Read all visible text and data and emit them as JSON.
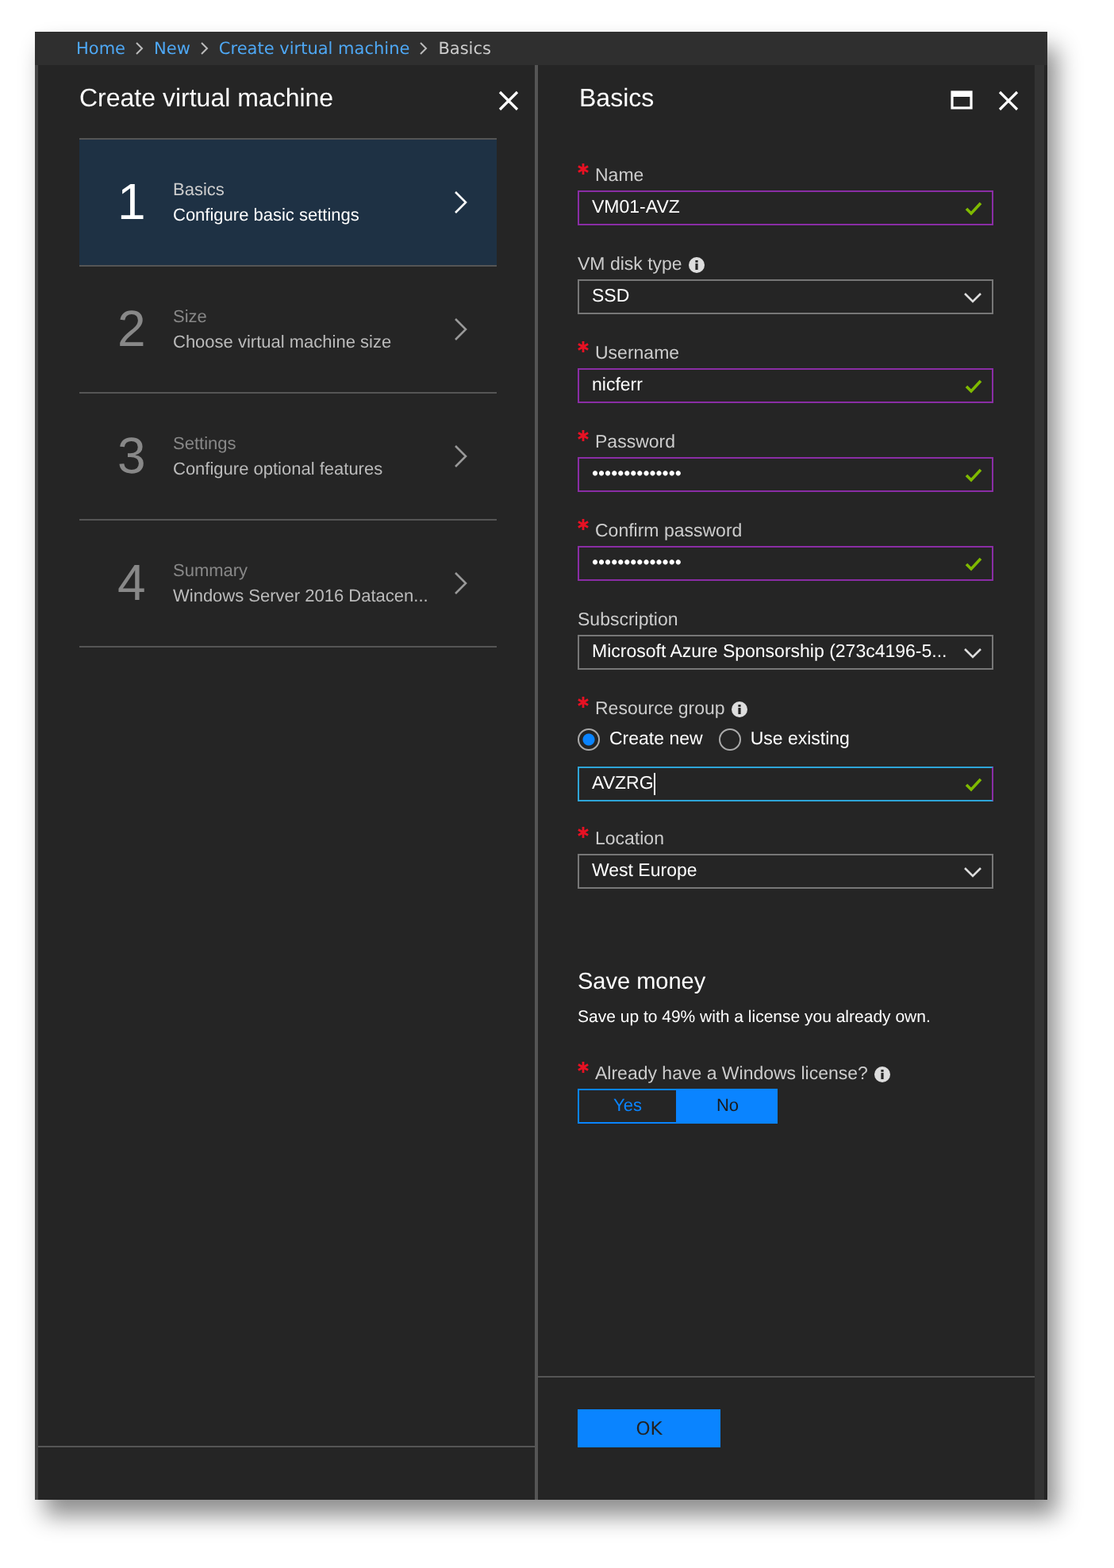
{
  "breadcrumb": [
    {
      "label": "Home",
      "current": false
    },
    {
      "label": "New",
      "current": false
    },
    {
      "label": "Create virtual machine",
      "current": false
    },
    {
      "label": "Basics",
      "current": true
    }
  ],
  "left_blade": {
    "title": "Create virtual machine",
    "steps": [
      {
        "number": "1",
        "title": "Basics",
        "subtitle": "Configure basic settings",
        "selected": true
      },
      {
        "number": "2",
        "title": "Size",
        "subtitle": "Choose virtual machine size",
        "selected": false
      },
      {
        "number": "3",
        "title": "Settings",
        "subtitle": "Configure optional features",
        "selected": false
      },
      {
        "number": "4",
        "title": "Summary",
        "subtitle": "Windows Server 2016 Datacen...",
        "selected": false
      }
    ]
  },
  "right_blade": {
    "title": "Basics",
    "fields": [
      {
        "kind": "text",
        "label": "Name",
        "required": true,
        "info": false,
        "value": "VM01-AVZ",
        "valid": true
      },
      {
        "kind": "select",
        "label": "VM disk type",
        "required": false,
        "info": true,
        "value": "SSD"
      },
      {
        "kind": "text",
        "label": "Username",
        "required": true,
        "info": false,
        "value": "nicferr",
        "valid": true
      },
      {
        "kind": "text",
        "label": "Password",
        "required": true,
        "info": false,
        "value": "••••••••••••••",
        "valid": true
      },
      {
        "kind": "text",
        "label": "Confirm password",
        "required": true,
        "info": false,
        "value": "••••••••••••••",
        "valid": true
      },
      {
        "kind": "select",
        "label": "Subscription",
        "required": false,
        "info": false,
        "value": "Microsoft Azure Sponsorship (273c4196-5..."
      },
      {
        "kind": "radio",
        "label": "Resource group",
        "required": true,
        "info": true,
        "options": [
          {
            "label": "Create new",
            "selected": true
          },
          {
            "label": "Use existing",
            "selected": false
          }
        ]
      },
      {
        "kind": "text",
        "value": "AVZRG",
        "valid": true,
        "focused": true
      },
      {
        "kind": "select",
        "label": "Location",
        "required": true,
        "info": false,
        "value": "West Europe"
      }
    ],
    "section": {
      "title": "Save money",
      "text": "Save up to 49% with a license you already own."
    },
    "license": {
      "label": "Already have a Windows license?",
      "required": true,
      "info": true,
      "options": [
        {
          "label": "Yes",
          "selected": false
        },
        {
          "label": "No",
          "selected": true
        }
      ]
    },
    "ok_button": "OK"
  }
}
